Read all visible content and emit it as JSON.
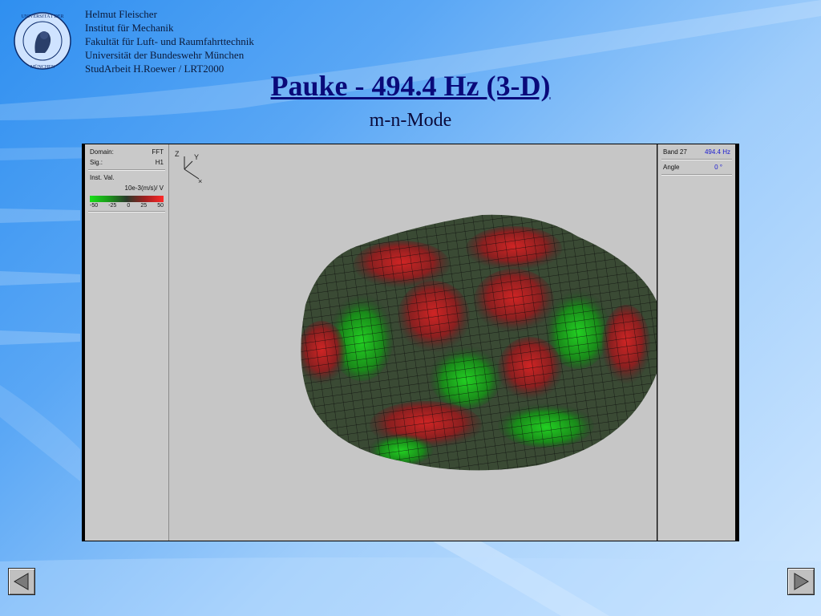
{
  "header": {
    "lines": [
      "Helmut Fleischer",
      "Institut für Mechanik",
      "Fakultät für Luft- und Raumfahrttechnik",
      "Universität der Bundeswehr München",
      "StudArbeit H.Roewer / LRT2000"
    ],
    "seal_icon": "university-seal-icon"
  },
  "slide": {
    "title": "Pauke - 494.4 Hz (3-D)",
    "subtitle": "m-n-Mode"
  },
  "left_panel": {
    "domain_label": "Domain:",
    "domain_value": "FFT",
    "sig_label": "Sig.:",
    "sig_value": "H1",
    "inst_label": "Inst. Val.",
    "unit": "10e-3(m/s)/ V",
    "ticks": [
      "-50",
      "-25",
      "0",
      "25",
      "50"
    ]
  },
  "right_panel": {
    "band_label": "Band 27",
    "band_value": "494.4 Hz",
    "angle_label": "Angle",
    "angle_value": "0 °"
  },
  "axis": {
    "z": "Z",
    "y": "Y"
  },
  "colors": {
    "peak": "#c02020",
    "trough": "#18c018",
    "neutral": "#2c3c2c",
    "panel": "#c9c9c9"
  },
  "nav": {
    "prev_icon": "triangle-left-icon",
    "next_icon": "triangle-right-icon"
  }
}
